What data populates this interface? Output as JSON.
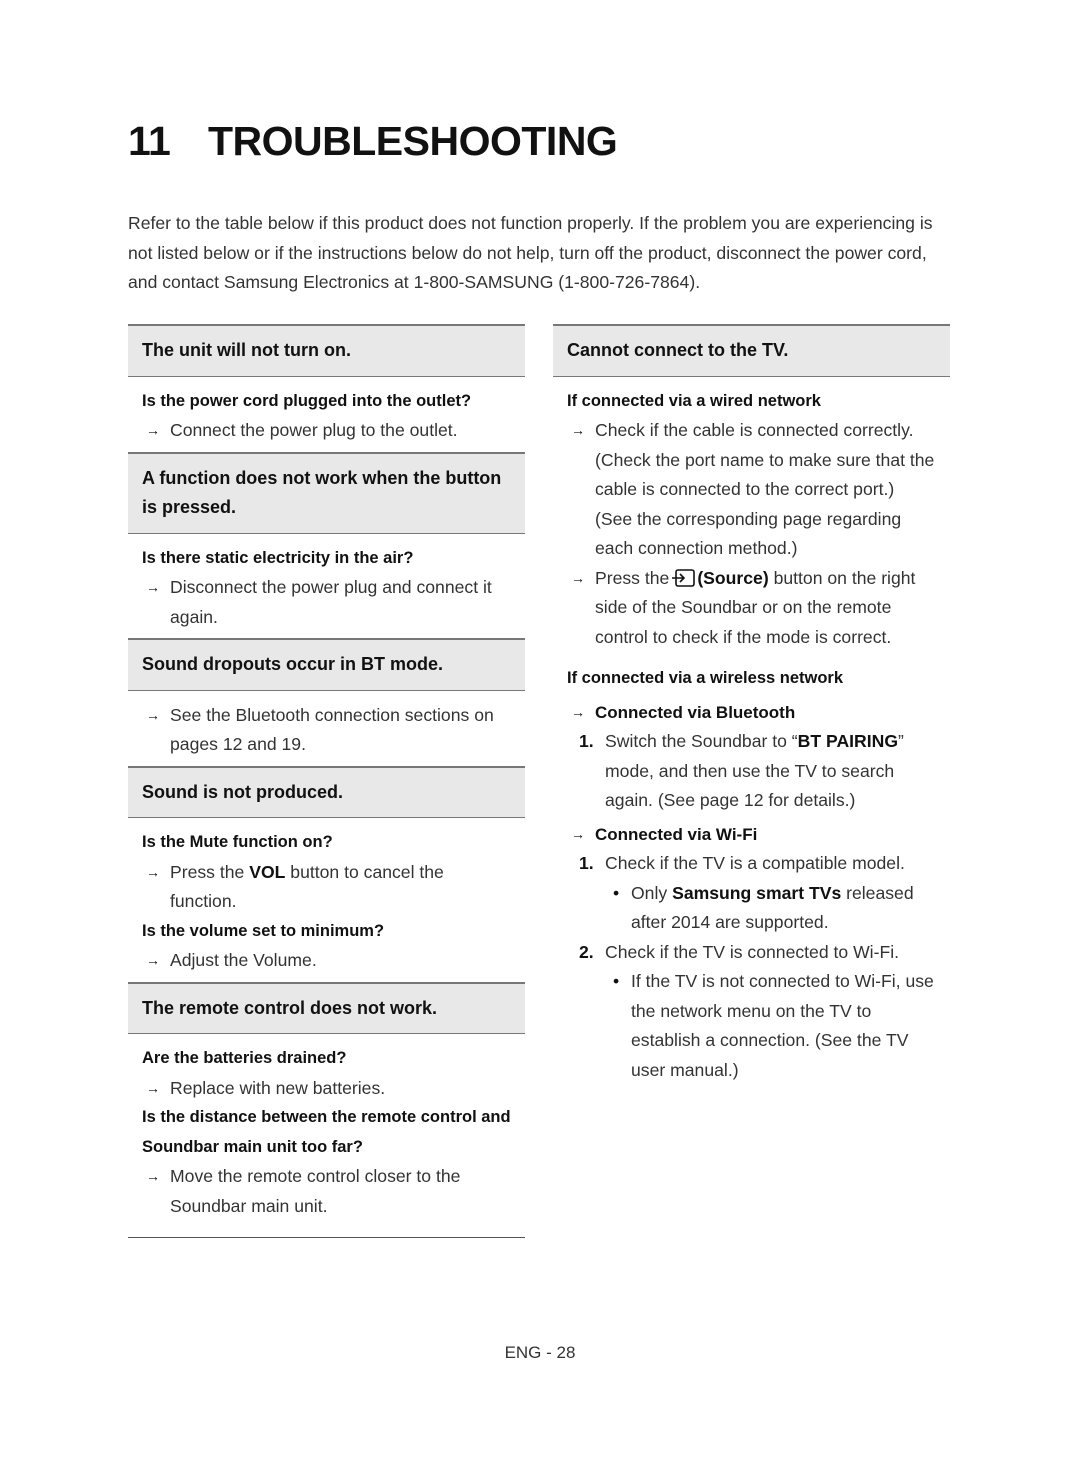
{
  "title": {
    "number": "11",
    "text": "TROUBLESHOOTING"
  },
  "intro": "Refer to the table below if this product does not function properly. If the problem you are experiencing is not listed below or if the instructions below do not help, turn off the product, disconnect the power cord, and contact Samsung Electronics at 1-800-SAMSUNG (1-800-726-7864).",
  "left": {
    "s1": {
      "head": "The unit will not turn on.",
      "q1": "Is the power cord plugged into the outlet?",
      "a1": "Connect the power plug to the outlet."
    },
    "s2": {
      "head": "A function does not work when the button is pressed.",
      "q1": "Is there static electricity in the air?",
      "a1": "Disconnect the power plug and connect it again."
    },
    "s3": {
      "head": "Sound dropouts occur in BT mode.",
      "a1": "See the Bluetooth connection sections on pages 12 and 19."
    },
    "s4": {
      "head": "Sound is not produced.",
      "q1": "Is the Mute function on?",
      "a1_pre": "Press the ",
      "a1_bold": "VOL",
      "a1_post": " button to cancel the function.",
      "q2": "Is the volume set to minimum?",
      "a2": "Adjust the Volume."
    },
    "s5": {
      "head": "The remote control does not work.",
      "q1": "Are the batteries drained?",
      "a1": "Replace with new batteries.",
      "q2": "Is the distance between the remote control and Soundbar main unit too far?",
      "a2": "Move the remote control closer to the Soundbar main unit."
    }
  },
  "right": {
    "head": "Cannot connect to the TV.",
    "wired": {
      "q": "If connected via a wired network",
      "a1": "Check if the cable is connected correctly. (Check the port name to make sure that the cable is connected to the correct port.) (See the corresponding page regarding each connection method.)",
      "a2_pre": "Press the",
      "a2_bold": "(Source)",
      "a2_post": " button on the right side of the Soundbar or on the remote control to check if the mode is correct."
    },
    "wireless": {
      "q": "If connected via a wireless network",
      "bt_head": "Connected via Bluetooth",
      "bt_1_num": "1.",
      "bt_1_pre": "Switch the Soundbar to “",
      "bt_1_bold": "BT PAIRING",
      "bt_1_post": "” mode, and then use the TV to search again. (See page 12 for details.)",
      "wifi_head": "Connected via Wi-Fi",
      "wifi_1_num": "1.",
      "wifi_1": "Check if the TV is a compatible model.",
      "wifi_1b_pre": "Only ",
      "wifi_1b_bold": "Samsung smart TVs",
      "wifi_1b_post": " released after 2014 are supported.",
      "wifi_2_num": "2.",
      "wifi_2": "Check if the TV is connected to Wi-Fi.",
      "wifi_2b": "If the TV is not connected to Wi-Fi, use the network menu on the TV to establish a connection. (See the TV user manual.)"
    }
  },
  "icons": {
    "arrow": "→",
    "bullet": "•"
  },
  "footer": "ENG - 28"
}
